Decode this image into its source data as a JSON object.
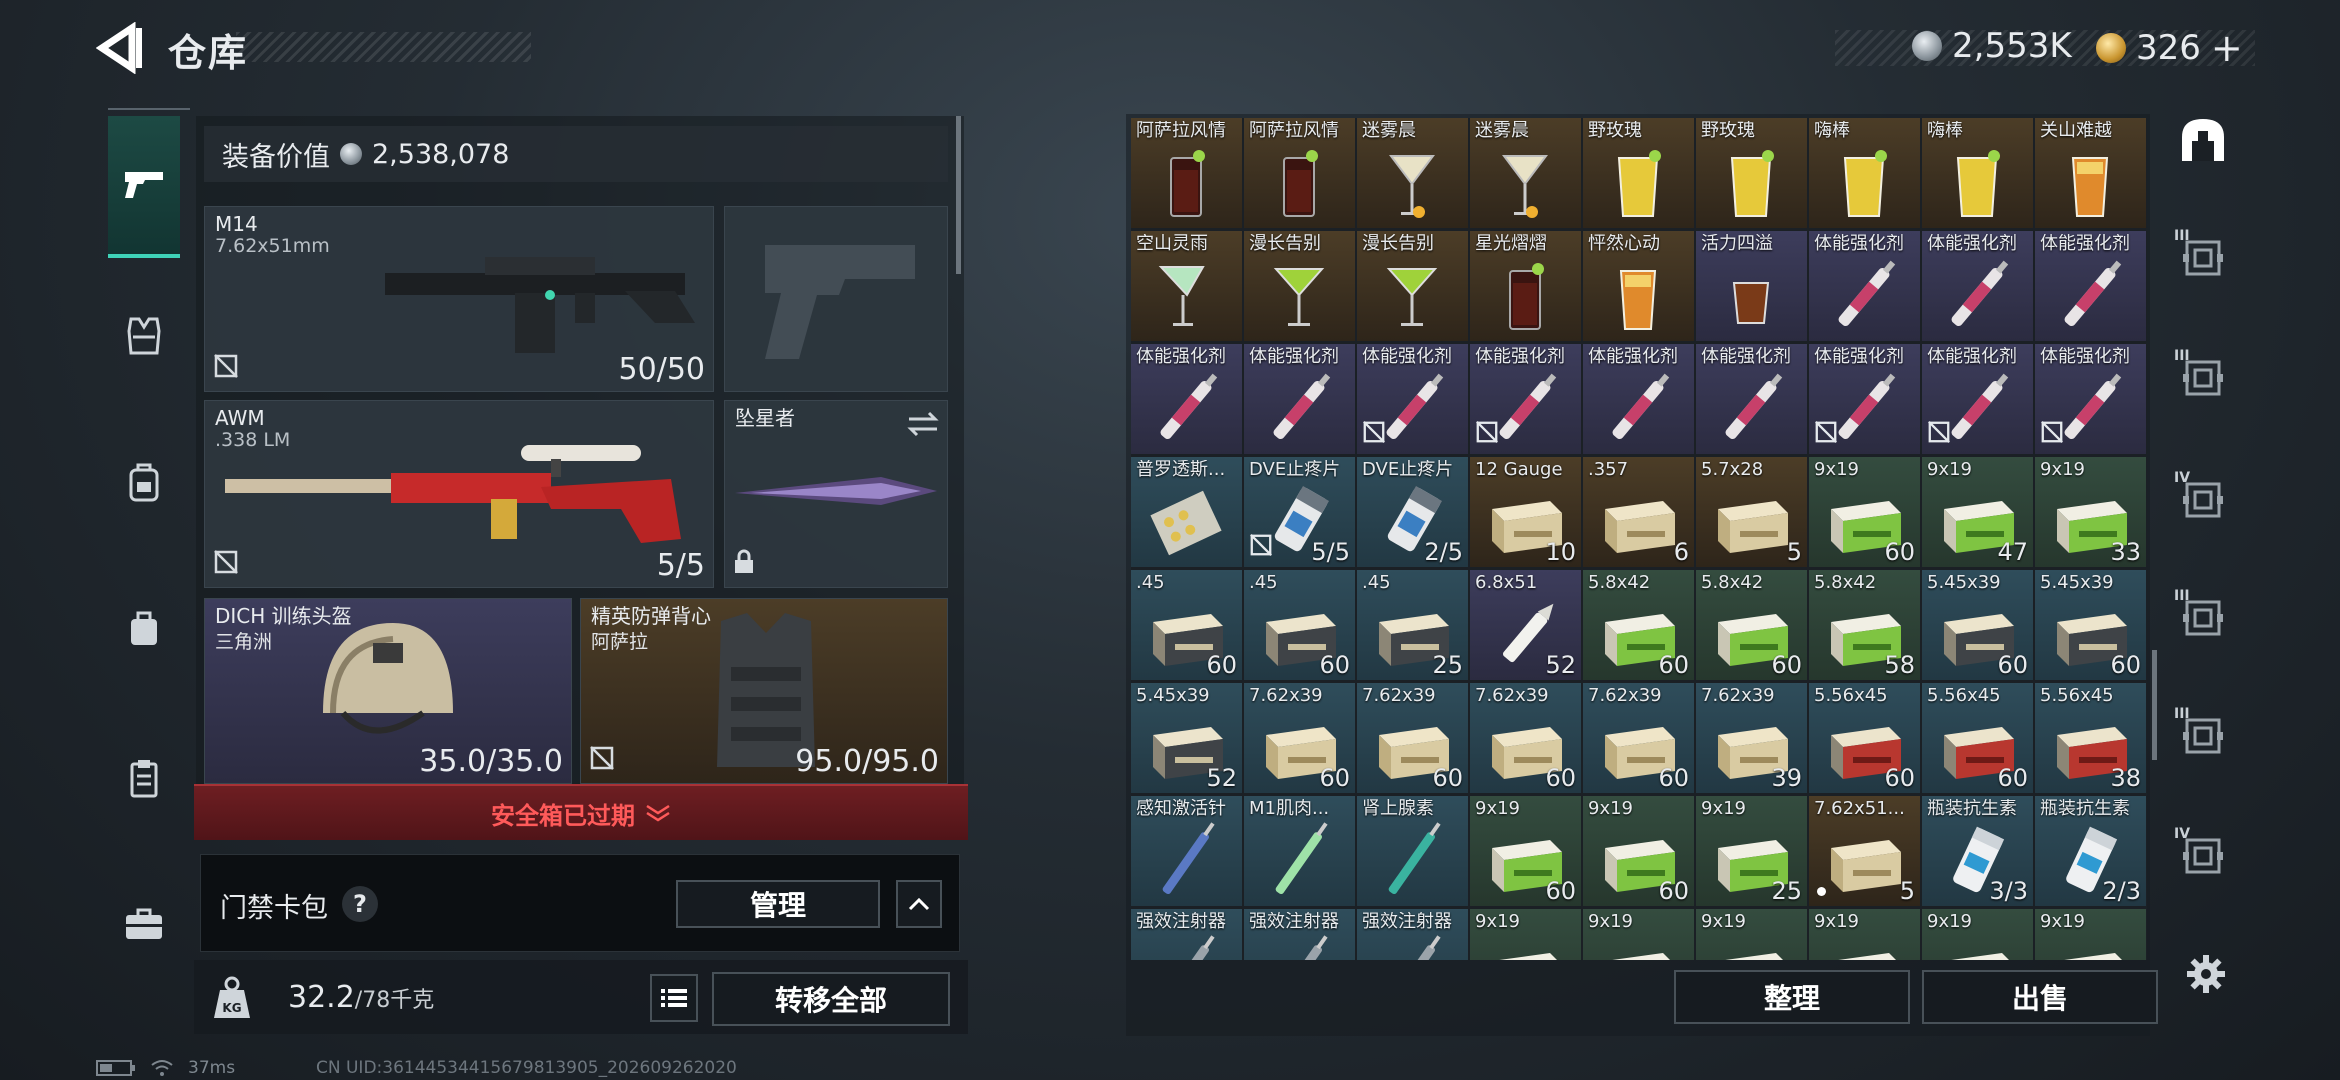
{
  "header": {
    "title": "仓库"
  },
  "currency": {
    "primary": "2,553K",
    "secondary": "326"
  },
  "equipment": {
    "value_label": "装备价值",
    "value": "2,538,078",
    "slots": {
      "primary": {
        "name": "M14",
        "caliber": "7.62x51mm",
        "count": "50/50"
      },
      "pistol": {
        "name": ""
      },
      "secondary": {
        "name": "AWM",
        "caliber": ".338 LM",
        "count": "5/5"
      },
      "melee": {
        "name": "坠星者"
      },
      "helmet": {
        "name": "DICH 训练头盔",
        "origin": "三角洲",
        "durability": "35.0/35.0"
      },
      "armor": {
        "name": "精英防弹背心",
        "origin": "阿萨拉",
        "durability": "95.0/95.0"
      }
    },
    "safe_box_status": "安全箱已过期",
    "card_pack_label": "门禁卡包",
    "help_icon": "?",
    "manage_label": "管理",
    "weight_current": "32.2",
    "weight_max": "/78千克",
    "weight_icon_text": "KG",
    "transfer_all_label": "转移全部"
  },
  "stash": {
    "rows": [
      [
        {
          "name": "阿萨拉风情",
          "tint": "gold",
          "icon": "cocktail-dark",
          "count": ""
        },
        {
          "name": "阿萨拉风情",
          "tint": "gold",
          "icon": "cocktail-dark",
          "count": ""
        },
        {
          "name": "迷雾晨",
          "tint": "gold",
          "icon": "cocktail-martini-clear",
          "count": ""
        },
        {
          "name": "迷雾晨",
          "tint": "gold",
          "icon": "cocktail-martini-clear",
          "count": ""
        },
        {
          "name": "野玫瑰",
          "tint": "gold",
          "icon": "cocktail-yellow",
          "count": ""
        },
        {
          "name": "野玫瑰",
          "tint": "gold",
          "icon": "cocktail-yellow",
          "count": ""
        },
        {
          "name": "嗨棒",
          "tint": "gold",
          "icon": "cocktail-yellow",
          "count": ""
        },
        {
          "name": "嗨棒",
          "tint": "gold",
          "icon": "cocktail-yellow",
          "count": ""
        },
        {
          "name": "关山难越",
          "tint": "gold",
          "icon": "cocktail-orange",
          "count": ""
        }
      ],
      [
        {
          "name": "空山灵雨",
          "tint": "gold",
          "icon": "cocktail-green-tall",
          "count": ""
        },
        {
          "name": "漫长告别",
          "tint": "gold",
          "icon": "cocktail-martini-green",
          "count": ""
        },
        {
          "name": "漫长告别",
          "tint": "gold",
          "icon": "cocktail-martini-green",
          "count": ""
        },
        {
          "name": "星光熠熠",
          "tint": "gold",
          "icon": "cocktail-dark",
          "count": ""
        },
        {
          "name": "怦然心动",
          "tint": "gold",
          "icon": "cocktail-orange",
          "count": ""
        },
        {
          "name": "活力四溢",
          "tint": "purple",
          "icon": "cocktail-tumbler",
          "count": ""
        },
        {
          "name": "体能强化剂",
          "tint": "purple",
          "icon": "injector-red",
          "count": ""
        },
        {
          "name": "体能强化剂",
          "tint": "purple",
          "icon": "injector-red",
          "count": ""
        },
        {
          "name": "体能强化剂",
          "tint": "purple",
          "icon": "injector-red",
          "count": ""
        }
      ],
      [
        {
          "name": "体能强化剂",
          "tint": "purple",
          "icon": "injector-red",
          "count": ""
        },
        {
          "name": "体能强化剂",
          "tint": "purple",
          "icon": "injector-red",
          "count": ""
        },
        {
          "name": "体能强化剂",
          "tint": "purple",
          "icon": "injector-red",
          "count": "",
          "lock": true
        },
        {
          "name": "体能强化剂",
          "tint": "purple",
          "icon": "injector-red",
          "count": "",
          "lock": true
        },
        {
          "name": "体能强化剂",
          "tint": "purple",
          "icon": "injector-red",
          "count": ""
        },
        {
          "name": "体能强化剂",
          "tint": "purple",
          "icon": "injector-red",
          "count": ""
        },
        {
          "name": "体能强化剂",
          "tint": "purple",
          "icon": "injector-red",
          "count": "",
          "lock": true
        },
        {
          "name": "体能强化剂",
          "tint": "purple",
          "icon": "injector-red",
          "count": "",
          "lock": true
        },
        {
          "name": "体能强化剂",
          "tint": "purple",
          "icon": "injector-red",
          "count": "",
          "lock": true
        }
      ],
      [
        {
          "name": "普罗透斯...",
          "tint": "blue",
          "icon": "pill-pack",
          "count": ""
        },
        {
          "name": "DVE止疼片",
          "tint": "blue",
          "icon": "pill-bottle",
          "count": "5/5",
          "lock": true
        },
        {
          "name": "DVE止疼片",
          "tint": "blue",
          "icon": "pill-bottle",
          "count": "2/5"
        },
        {
          "name": "12 Gauge",
          "tint": "gold",
          "icon": "ammo-box-tan",
          "count": "10"
        },
        {
          "name": ".357",
          "tint": "gold",
          "icon": "ammo-box-tan",
          "count": "6"
        },
        {
          "name": "5.7x28",
          "tint": "gold",
          "icon": "ammo-box-tan",
          "count": "5"
        },
        {
          "name": "9x19",
          "tint": "green",
          "icon": "ammo-box-green",
          "count": "60"
        },
        {
          "name": "9x19",
          "tint": "green",
          "icon": "ammo-box-green",
          "count": "47"
        },
        {
          "name": "9x19",
          "tint": "green",
          "icon": "ammo-box-green",
          "count": "33"
        }
      ],
      [
        {
          "name": ".45",
          "tint": "blue",
          "icon": "ammo-box-grey",
          "count": "60"
        },
        {
          "name": ".45",
          "tint": "blue",
          "icon": "ammo-box-grey",
          "count": "60"
        },
        {
          "name": ".45",
          "tint": "blue",
          "icon": "ammo-box-grey",
          "count": "25"
        },
        {
          "name": "6.8x51",
          "tint": "purple",
          "icon": "cartridge-white",
          "count": "52"
        },
        {
          "name": "5.8x42",
          "tint": "green",
          "icon": "ammo-box-green",
          "count": "60"
        },
        {
          "name": "5.8x42",
          "tint": "green",
          "icon": "ammo-box-green",
          "count": "60"
        },
        {
          "name": "5.8x42",
          "tint": "green",
          "icon": "ammo-box-green",
          "count": "58"
        },
        {
          "name": "5.45x39",
          "tint": "blue",
          "icon": "ammo-box-grey",
          "count": "60"
        },
        {
          "name": "5.45x39",
          "tint": "blue",
          "icon": "ammo-box-grey",
          "count": "60"
        }
      ],
      [
        {
          "name": "5.45x39",
          "tint": "blue",
          "icon": "ammo-box-grey",
          "count": "52"
        },
        {
          "name": "7.62x39",
          "tint": "blue",
          "icon": "ammo-box-tan",
          "count": "60"
        },
        {
          "name": "7.62x39",
          "tint": "blue",
          "icon": "ammo-box-tan",
          "count": "60"
        },
        {
          "name": "7.62x39",
          "tint": "blue",
          "icon": "ammo-box-tan",
          "count": "60"
        },
        {
          "name": "7.62x39",
          "tint": "blue",
          "icon": "ammo-box-tan",
          "count": "60"
        },
        {
          "name": "7.62x39",
          "tint": "blue",
          "icon": "ammo-box-tan",
          "count": "39"
        },
        {
          "name": "5.56x45",
          "tint": "blue",
          "icon": "ammo-box-red",
          "count": "60"
        },
        {
          "name": "5.56x45",
          "tint": "blue",
          "icon": "ammo-box-red",
          "count": "60"
        },
        {
          "name": "5.56x45",
          "tint": "blue",
          "icon": "ammo-box-red",
          "count": "38"
        }
      ],
      [
        {
          "name": "感知激活针",
          "tint": "blue",
          "icon": "syringe-blue",
          "count": ""
        },
        {
          "name": "M1肌肉...",
          "tint": "blue",
          "icon": "syringe-green",
          "count": ""
        },
        {
          "name": "肾上腺素",
          "tint": "blue",
          "icon": "syringe-teal",
          "count": ""
        },
        {
          "name": "9x19",
          "tint": "green",
          "icon": "ammo-box-green",
          "count": "60"
        },
        {
          "name": "9x19",
          "tint": "green",
          "icon": "ammo-box-green",
          "count": "60"
        },
        {
          "name": "9x19",
          "tint": "green",
          "icon": "ammo-box-green",
          "count": "25"
        },
        {
          "name": "7.62x51...",
          "tint": "gold",
          "icon": "ammo-box-tan",
          "count": "5",
          "dot": true
        },
        {
          "name": "瓶装抗生素",
          "tint": "blue",
          "icon": "bottle-white",
          "count": "3/3"
        },
        {
          "name": "瓶装抗生素",
          "tint": "blue",
          "icon": "bottle-white",
          "count": "2/3"
        }
      ],
      [
        {
          "name": "强效注射器",
          "tint": "blue",
          "icon": "syringe-grey",
          "count": ""
        },
        {
          "name": "强效注射器",
          "tint": "blue",
          "icon": "syringe-grey",
          "count": ""
        },
        {
          "name": "强效注射器",
          "tint": "blue",
          "icon": "syringe-grey",
          "count": ""
        },
        {
          "name": "9x19",
          "tint": "green",
          "icon": "ammo-box-green",
          "count": ""
        },
        {
          "name": "9x19",
          "tint": "green",
          "icon": "ammo-box-green",
          "count": ""
        },
        {
          "name": "9x19",
          "tint": "green",
          "icon": "ammo-box-green",
          "count": ""
        },
        {
          "name": "9x19",
          "tint": "green",
          "icon": "ammo-box-green",
          "count": ""
        },
        {
          "name": "9x19",
          "tint": "green",
          "icon": "ammo-box-green",
          "count": ""
        },
        {
          "name": "9x19",
          "tint": "green",
          "icon": "ammo-box-green",
          "count": ""
        }
      ]
    ],
    "sort_label": "整理",
    "sell_label": "出售"
  },
  "right_rail": {
    "roman": [
      "",
      "III",
      "III",
      "IV",
      "III",
      "III",
      "IV"
    ]
  },
  "footer": {
    "ping": "37ms",
    "uid": "CN UID:3614453441567981390​5_202609262020"
  },
  "colors": {
    "accent": "#3fd3b8",
    "danger": "#ff5a5a",
    "panel": "#2e373f"
  }
}
